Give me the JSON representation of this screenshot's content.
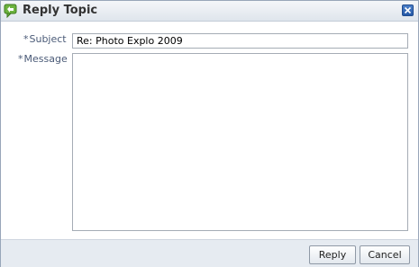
{
  "dialog": {
    "title": "Reply Topic",
    "icon": "reply-topic-icon",
    "close_icon": "close-icon"
  },
  "form": {
    "subject": {
      "required_marker": "*",
      "label": "Subject",
      "value": "Re: Photo Explo 2009"
    },
    "message": {
      "required_marker": "*",
      "label": "Message",
      "value": ""
    }
  },
  "footer": {
    "reply_label": "Reply",
    "cancel_label": "Cancel"
  },
  "colors": {
    "label_text": "#4a5a77",
    "close_button": "#2458a6",
    "footer_bg": "#e6ebf1"
  }
}
